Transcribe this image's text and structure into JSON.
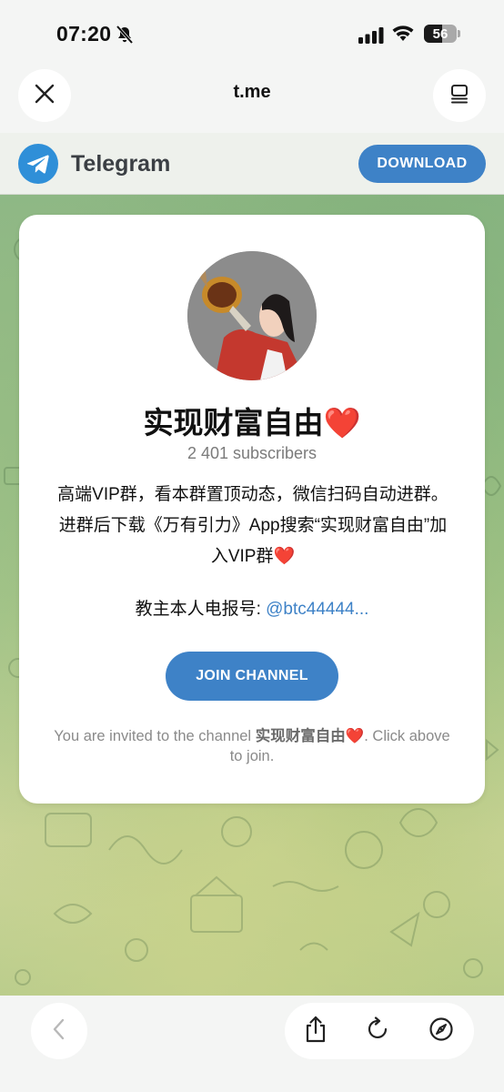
{
  "status_bar": {
    "time": "07:20",
    "battery_level": "56",
    "icons": [
      "bell-slash-icon",
      "cellular-signal-icon",
      "wifi-icon",
      "battery-icon"
    ]
  },
  "browser": {
    "url": "t.me",
    "close_icon": "close-icon",
    "menu_icon": "tabs-menu-icon"
  },
  "telegram_banner": {
    "name": "Telegram",
    "download_label": "DOWNLOAD",
    "logo_icon": "telegram-plane-icon"
  },
  "channel": {
    "title_text": "实现财富自由",
    "title_heart": "❤️",
    "subscribers": "2 401 subscribers",
    "description_line1": "高端VIP群，看本群置顶动态，微信扫码自动进群。",
    "description_line2": "进群后下载《万有引力》App搜索“实现财富自由”加",
    "description_line3": "入VIP群",
    "description_heart": "❤️",
    "contact_label": "教主本人电报号: ",
    "contact_link": "@btc44444...",
    "join_label": "JOIN CHANNEL",
    "invite_prefix": "You are invited to the channel ",
    "invite_channel": "实现财富自由",
    "invite_heart": "❤️",
    "invite_suffix": ". Click above to join."
  },
  "bottom_toolbar": {
    "icons": [
      "back-chevron-icon",
      "share-icon",
      "reload-icon",
      "compass-icon"
    ]
  },
  "colors": {
    "accent": "#3e82c7",
    "telegram_blue": "#2f8fd8",
    "heart": "#e0242b"
  }
}
